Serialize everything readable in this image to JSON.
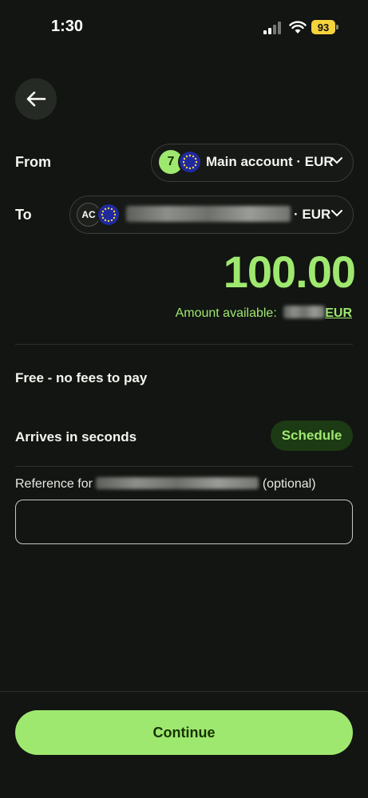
{
  "status_bar": {
    "time": "1:30",
    "battery": "93"
  },
  "from": {
    "label": "From",
    "wise_glyph": "7",
    "account": "Main account · EUR",
    "icon": "chevron-down-icon"
  },
  "to": {
    "label": "To",
    "initials": "AC",
    "account_suffix": "· EUR",
    "icon": "chevron-down-icon"
  },
  "amount": "100.00",
  "available": {
    "label": "Amount available:",
    "currency": "EUR"
  },
  "fees": "Free - no fees to pay",
  "arrival": {
    "text": "Arrives in seconds",
    "schedule_label": "Schedule"
  },
  "reference": {
    "prefix": "Reference for",
    "suffix": "(optional)",
    "value": ""
  },
  "continue_label": "Continue",
  "colors": {
    "accent": "#9fe870",
    "background": "#121511",
    "schedule_bg": "#1c3a13"
  }
}
